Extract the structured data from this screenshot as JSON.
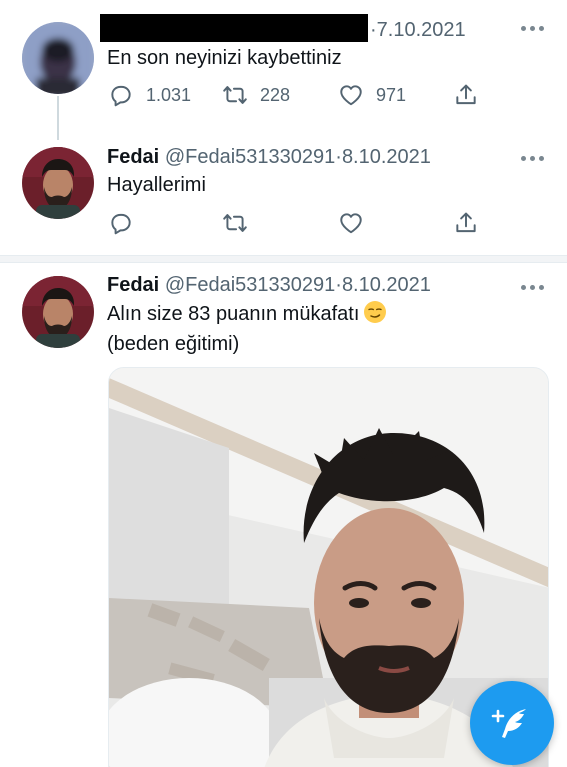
{
  "tweets": [
    {
      "name": "",
      "handle": "",
      "date": "7.10.2021",
      "text": "En son neyinizi kaybettiniz",
      "stats": {
        "reply": "1.031",
        "retweet": "228",
        "like": "971"
      }
    },
    {
      "name": "Fedai",
      "handle": "@Fedai531330291",
      "date": "8.10.2021",
      "text": "Hayallerimi",
      "stats": {
        "reply": "",
        "retweet": "",
        "like": ""
      }
    },
    {
      "name": "Fedai",
      "handle": "@Fedai531330291",
      "date": "8.10.2021",
      "text_line1": "Alın size 83 puanın mükafatı",
      "text_line2": "(beden eğitimi)",
      "emoji": "smirking-face-emoji"
    }
  ],
  "separator": "·",
  "icons": {
    "reply": "reply-icon",
    "retweet": "retweet-icon",
    "like": "heart-icon",
    "share": "share-icon",
    "more": "more-icon",
    "compose": "compose-tweet-icon"
  },
  "colors": {
    "primary_text": "#0f1419",
    "secondary_text": "#536471",
    "accent": "#1d9bf0",
    "divider": "#e6ecf0"
  }
}
